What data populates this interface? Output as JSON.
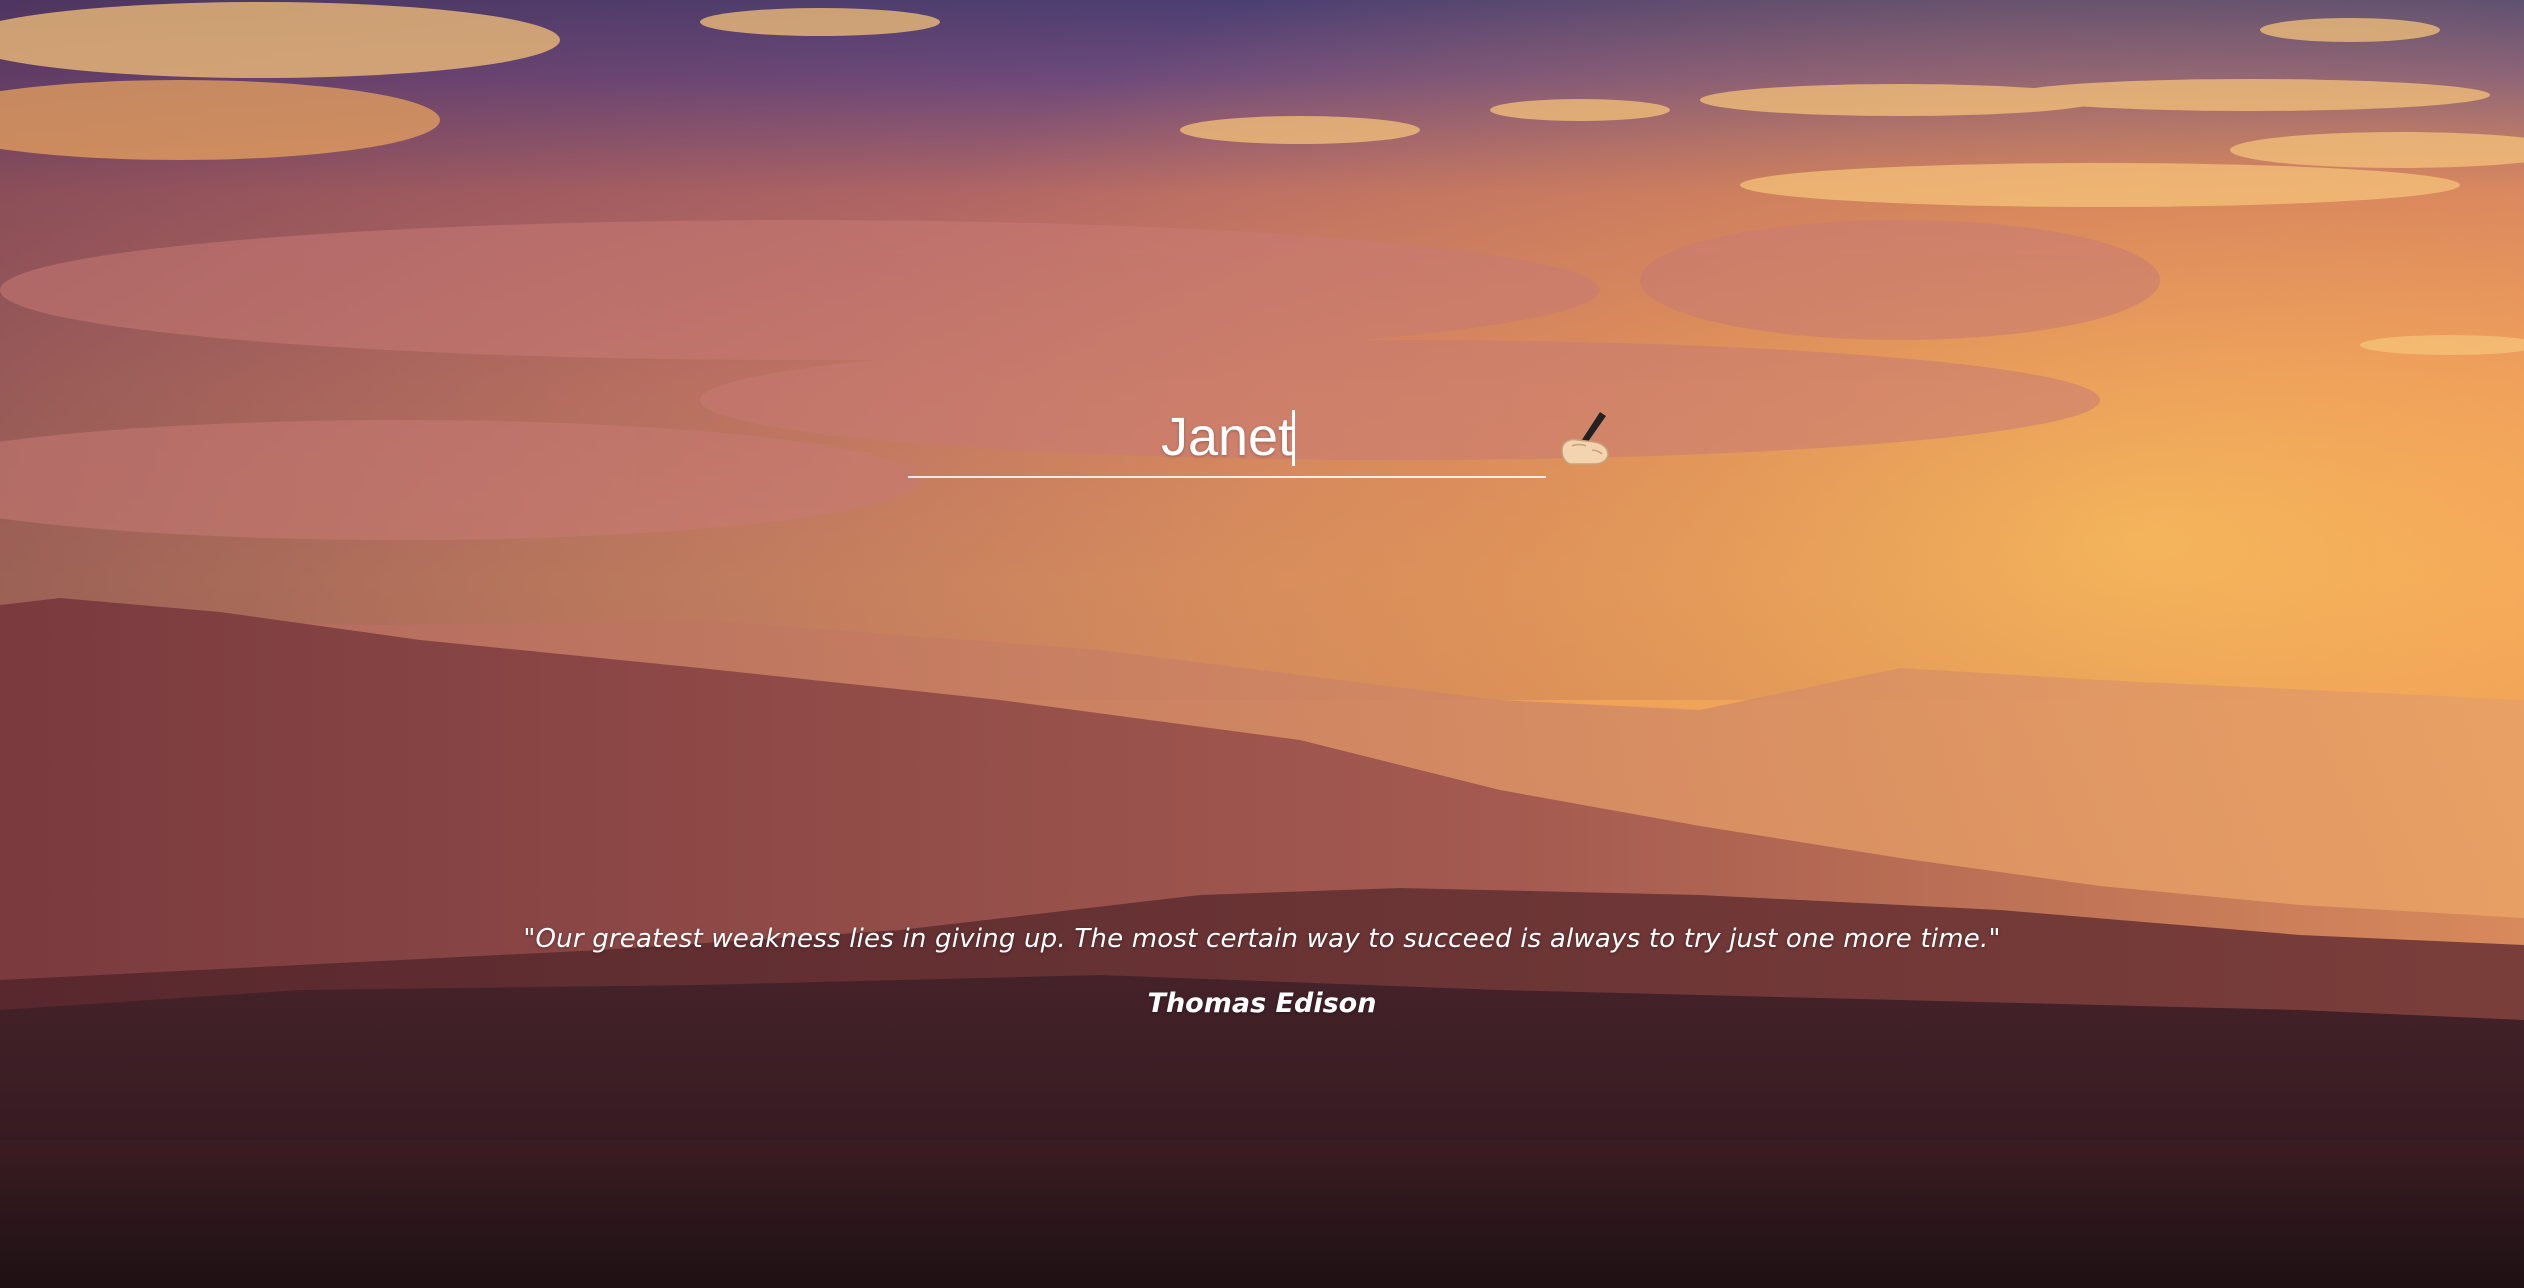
{
  "name_field": {
    "value": "Janet"
  },
  "edit_icon": "writing-hand-icon",
  "quote": {
    "text": "\"Our greatest weakness lies in giving up. The most certain way to succeed is always to try just one more time.\"",
    "author": "Thomas Edison"
  },
  "colors": {
    "sky_top": "#3f3f78",
    "sky_glow": "#f3a45a",
    "mountain_dark": "#3a1e22",
    "text": "#ffffff"
  }
}
